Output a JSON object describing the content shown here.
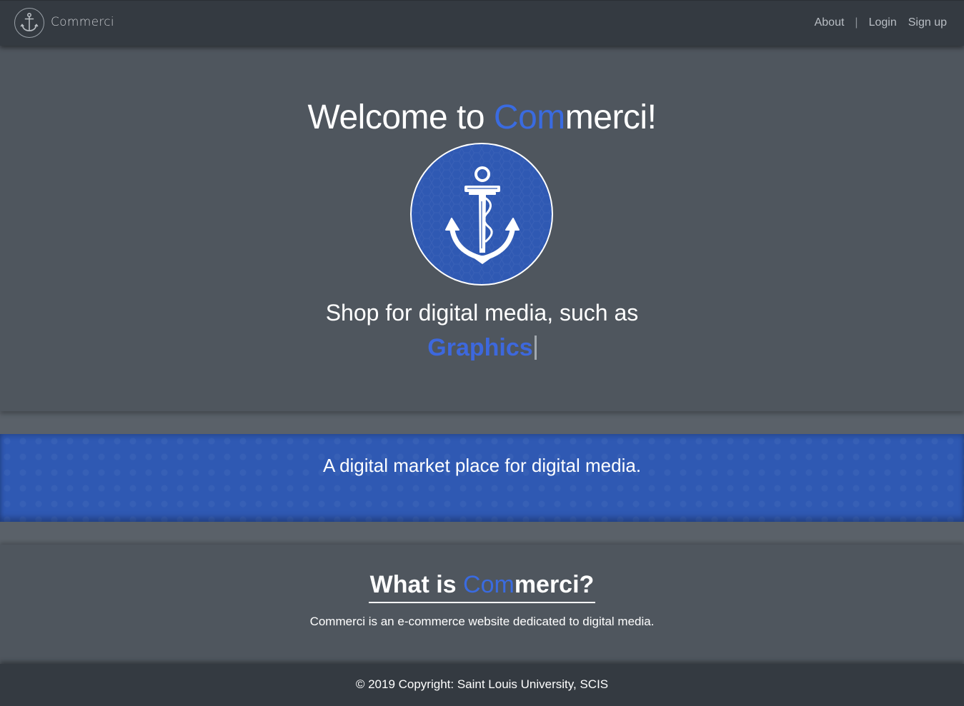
{
  "brand": {
    "name": "Commerci"
  },
  "nav": {
    "about": "About",
    "separator": "|",
    "login": "Login",
    "signup": "Sign up"
  },
  "hero": {
    "title_prefix": "Welcome to ",
    "title_highlight": "Com",
    "title_suffix": "merci!",
    "subtitle": "Shop for digital media, such as",
    "typed_word": "Graphics"
  },
  "band": {
    "text": "A digital market place for digital media."
  },
  "about": {
    "title_prefix": "What is ",
    "title_highlight": "Com",
    "title_suffix": "merci?",
    "description": "Commerci is an e-commerce website dedicated to digital media."
  },
  "footer": {
    "copyright": "© 2019 Copyright: Saint Louis University, SCIS"
  },
  "colors": {
    "navbar": "#343a41",
    "hero_bg": "#4f565e",
    "accent_blue": "#3a6be0",
    "band_blue": "#2f59b3"
  },
  "icons": {
    "brand_logo": "anchor-icon",
    "hero_emblem": "anchor-icon"
  }
}
